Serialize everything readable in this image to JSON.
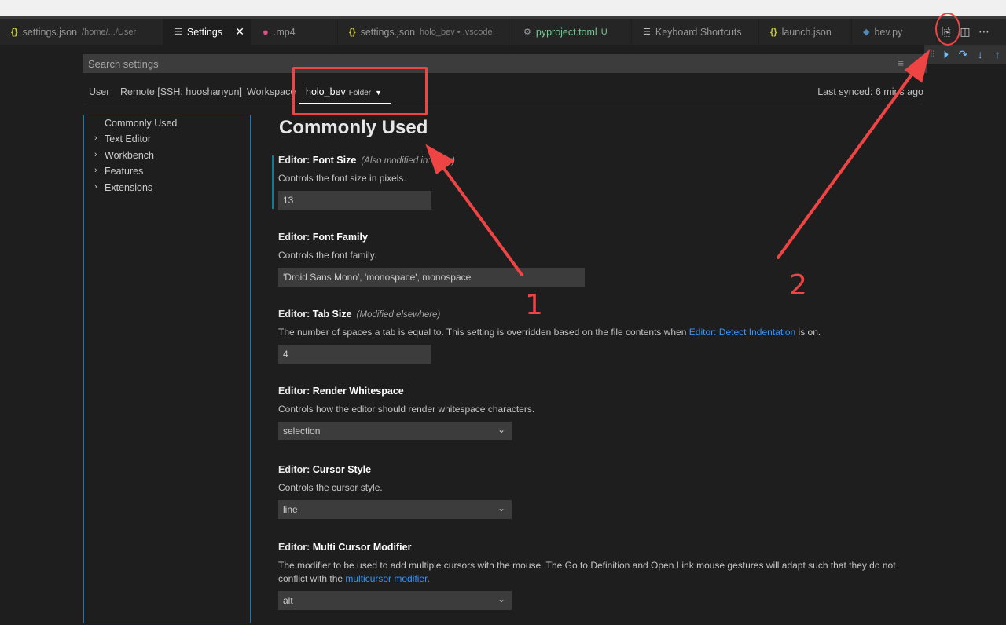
{
  "tabs": [
    {
      "label": "settings.json",
      "desc": "/home/.../User",
      "icon": "json-braces-icon"
    },
    {
      "label": "Settings",
      "icon": "settings-list-icon",
      "active": true,
      "close": "✕"
    },
    {
      "label": ".mp4",
      "icon": "media-icon"
    },
    {
      "label": "settings.json",
      "desc": "holo_bev • .vscode",
      "icon": "json-braces-icon"
    },
    {
      "label": "pyproject.toml",
      "badge": "U",
      "icon": "gear-icon"
    },
    {
      "label": "Keyboard Shortcuts",
      "icon": "keyboard-lines-icon"
    },
    {
      "label": "launch.json",
      "icon": "json-braces-icon"
    },
    {
      "label": "bev.py",
      "icon": "python-icon"
    }
  ],
  "search": {
    "placeholder": "Search settings"
  },
  "scope_tabs": {
    "user": "User",
    "remote": "Remote [SSH: huoshanyun]",
    "workspace": "Workspace",
    "folder": "holo_bev",
    "folder_tag": "Folder",
    "last_synced": "Last synced: 6 mins ago"
  },
  "toc": [
    {
      "label": "Commonly Used",
      "expandable": false
    },
    {
      "label": "Text Editor",
      "expandable": true
    },
    {
      "label": "Workbench",
      "expandable": true
    },
    {
      "label": "Features",
      "expandable": true
    },
    {
      "label": "Extensions",
      "expandable": true
    }
  ],
  "section_title": "Commonly Used",
  "settings": [
    {
      "category": "Editor: ",
      "name": "Font Size",
      "note": "(Also modified in: User)",
      "desc": "Controls the font size in pixels.",
      "value": "13"
    },
    {
      "category": "Editor: ",
      "name": "Font Family",
      "desc": "Controls the font family.",
      "value": "'Droid Sans Mono', 'monospace', monospace"
    },
    {
      "category": "Editor: ",
      "name": "Tab Size",
      "note": "(Modified elsewhere)",
      "desc_pre": "The number of spaces a tab is equal to. This setting is overridden based on the file contents when ",
      "desc_link": "Editor: Detect Indentation",
      "desc_post": " is on.",
      "value": "4"
    },
    {
      "category": "Editor: ",
      "name": "Render Whitespace",
      "desc": "Controls how the editor should render whitespace characters.",
      "value": "selection"
    },
    {
      "category": "Editor: ",
      "name": "Cursor Style",
      "desc": "Controls the cursor style.",
      "value": "line"
    },
    {
      "category": "Editor: ",
      "name": "Multi Cursor Modifier",
      "desc_pre": "The modifier to be used to add multiple cursors with the mouse. The Go to Definition and Open Link mouse gestures will adapt such that they do not conflict with the ",
      "desc_link": "multicursor modifier",
      "desc_post": ".",
      "value": "alt"
    }
  ],
  "annotations": {
    "label_1": "1",
    "label_2": "2"
  },
  "colors": {
    "accent": "#007fd4",
    "annotation": "#ef4444",
    "link": "#3794ff"
  }
}
